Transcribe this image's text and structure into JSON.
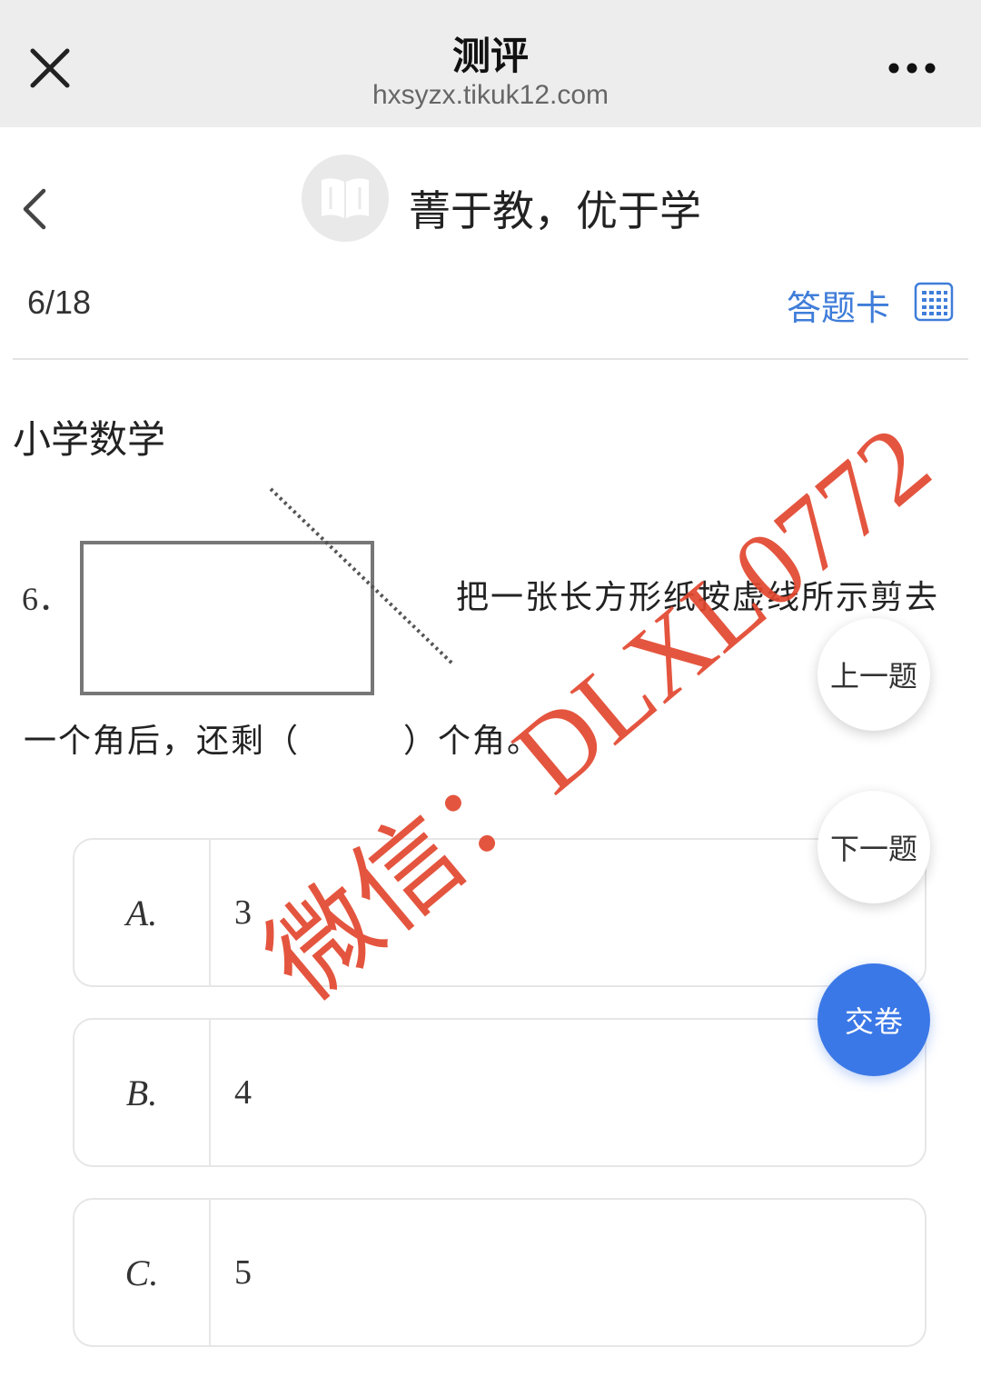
{
  "browser": {
    "title": "测评",
    "url": "hxsyzx.tikuk12.com",
    "close_icon": "close-icon",
    "more_icon": "more-dots-icon"
  },
  "header": {
    "slogan": "菁于教，优于学",
    "back_icon": "chevron-left-icon",
    "logo_icon": "book-icon"
  },
  "progress": {
    "text": "6/18",
    "answer_card_label": "答题卡",
    "answer_card_icon": "grid-icon"
  },
  "subject": "小学数学",
  "question": {
    "number": "6．",
    "text_line1": "把一张长方形纸按虚线所示剪去",
    "text_line2": "一个角后，还剩（　　　）个角。"
  },
  "options": [
    {
      "letter": "A.",
      "value": "3"
    },
    {
      "letter": "B.",
      "value": "4"
    },
    {
      "letter": "C.",
      "value": "5"
    }
  ],
  "floating": {
    "prev": "上一题",
    "next": "下一题",
    "submit": "交卷"
  },
  "watermark": "微信：DLXL0772",
  "colors": {
    "accent": "#3b78e7",
    "link": "#3f7dd9",
    "watermark": "#e2472f"
  }
}
